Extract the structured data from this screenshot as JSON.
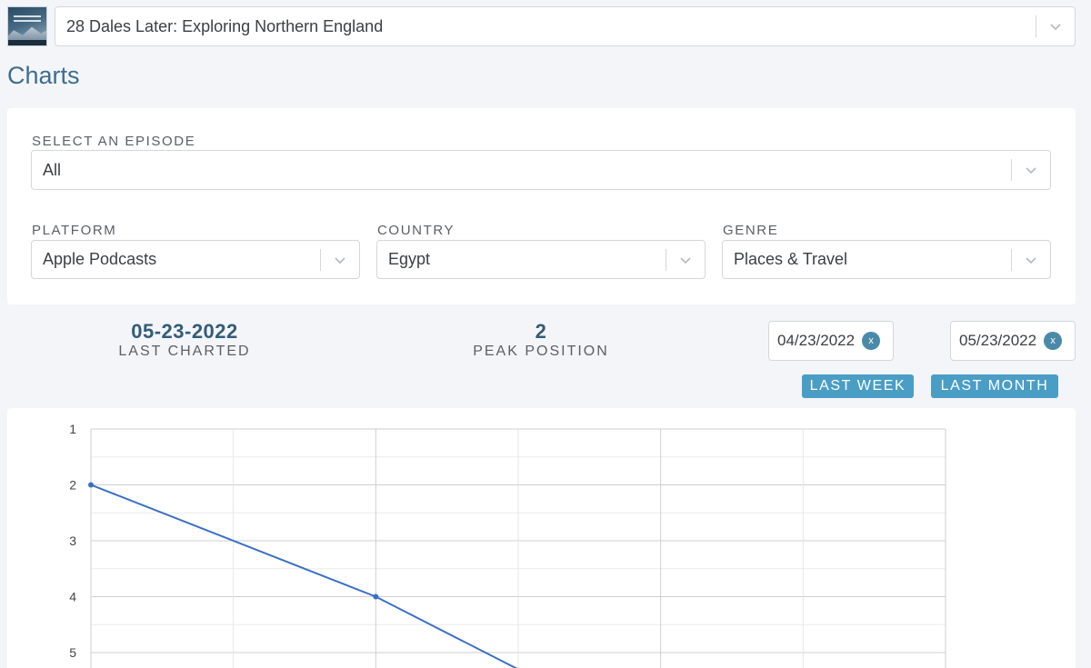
{
  "header": {
    "podcast_select_value": "28 Dales Later: Exploring Northern England",
    "art_icon": "podcast-cover-image"
  },
  "page": {
    "title": "Charts"
  },
  "filters": {
    "episode": {
      "label": "SELECT AN EPISODE",
      "value": "All"
    },
    "platform": {
      "label": "PLATFORM",
      "value": "Apple Podcasts"
    },
    "country": {
      "label": "COUNTRY",
      "value": "Egypt"
    },
    "genre": {
      "label": "GENRE",
      "value": "Places & Travel"
    }
  },
  "stats": {
    "last_charted": {
      "value": "05-23-2022",
      "label": "LAST CHARTED"
    },
    "peak_position": {
      "value": "2",
      "label": "PEAK POSITION"
    }
  },
  "date_range": {
    "start": "04/23/2022",
    "end": "05/23/2022",
    "clear_glyph": "x",
    "last_week_label": "LAST WEEK",
    "last_month_label": "LAST MONTH"
  },
  "colors": {
    "accent": "#3e6d8e",
    "button": "#4a9ec6",
    "line": "#3a6fc4"
  },
  "chart_data": {
    "type": "line",
    "y_ticks": [
      "1",
      "2",
      "3",
      "4",
      "5"
    ],
    "ylim": [
      1,
      5
    ],
    "y_inverted": true,
    "grid": true,
    "x_index": [
      0,
      2,
      3
    ],
    "x_range": [
      0,
      6
    ],
    "series": [
      {
        "values": [
          2,
          4,
          5.3
        ]
      }
    ]
  }
}
